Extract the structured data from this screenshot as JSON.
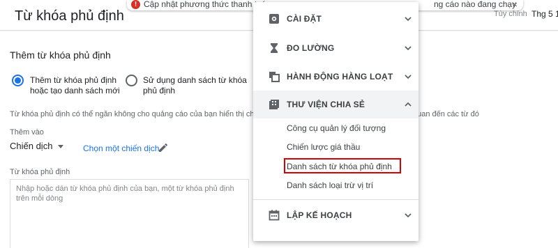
{
  "header": {
    "title": "Từ khóa phủ định",
    "date_hint": "Tùy chỉnh",
    "date_value": "Thg 5 1"
  },
  "notification": {
    "icon": "error-icon",
    "text_start": "Cập nhật phương thức thanh toá",
    "text_end": "ng cáo nào đang chạy",
    "close_label": "×"
  },
  "form": {
    "section_title": "Thêm từ khóa phủ định",
    "option_new": "Thêm từ khóa phủ định hoặc tạo danh sách mới",
    "option_list": "Sử dụng danh sách từ khóa phủ định",
    "description": "Từ khóa phủ định có thể ngăn không cho quảng cáo của bạn hiển thị ch",
    "description_tail": "quan đến các từ đó",
    "add_to_label": "Thêm vào",
    "level_value": "Chiến dịch",
    "choose_campaign": "Chọn một chiến dịch",
    "keywords_label": "Từ khóa phủ định",
    "keywords_placeholder": "Nhập hoặc dán từ khóa phủ định của bạn, một từ khóa phủ định trên mỗi dòng"
  },
  "menu": {
    "items": [
      {
        "label": "CÀI ĐẶT",
        "icon": "gear-icon",
        "expanded": false
      },
      {
        "label": "ĐO LƯỜNG",
        "icon": "hourglass-icon",
        "expanded": false
      },
      {
        "label": "HÀNH ĐỘNG HÀNG LOẠT",
        "icon": "copy-icon",
        "expanded": false
      },
      {
        "label": "THƯ VIỆN CHIA SẺ",
        "icon": "library-icon",
        "expanded": true
      },
      {
        "label": "LẬP KẾ HOẠCH",
        "icon": "calendar-icon",
        "expanded": false
      }
    ],
    "library_subitems": [
      "Công cụ quản lý đối tượng",
      "Chiến lược giá thầu",
      "Danh sách từ khóa phủ định",
      "Danh sách loại trừ vị trí"
    ]
  },
  "colors": {
    "accent": "#1a73e8",
    "highlight_border": "#d50000",
    "error": "#d93025"
  }
}
